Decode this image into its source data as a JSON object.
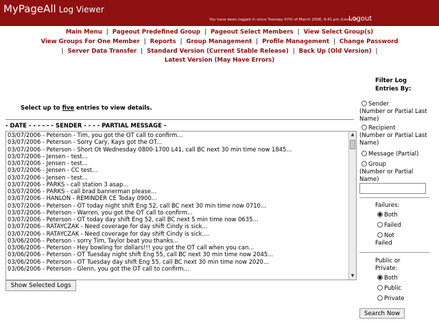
{
  "header": {
    "brand": "MyPageAll",
    "subtitle": "Log Viewer",
    "login_info": "You have been logged in since Tuesday 07th of March 2006, 9:41 pm (Level 2)",
    "logout": "Logout",
    "bg_color": "#8f1010"
  },
  "nav": {
    "link_color": "#8f1010",
    "lines": [
      [
        "Main Menu",
        "Pageout Predefined Group",
        "Pageout Select Members",
        "View Select Group(s)"
      ],
      [
        "View Groups For One Member",
        "Reports",
        "Group Management",
        "Profile Management",
        "Change Password"
      ],
      [
        "Server Data Transfer",
        "Standard Version (Current Stable Release)",
        "Back Up (Old Version)"
      ],
      [
        "Latest Version (May Have Errors)"
      ]
    ]
  },
  "main": {
    "instructions_prefix": "Select up to ",
    "instructions_emph": "five",
    "instructions_suffix": " entries to view details.",
    "column_header": "- DATE - - - - - - SENDER - - - - PARTIAL MESSAGE -",
    "show_button": "Show Selected Logs",
    "log_entries": [
      "03/07/2006 - Peterson - Tim, you got the OT call to confirm...",
      "03/07/2006 - Peterson - Sorry Cary, Kays got the OT...",
      "03/07/2006 - Peterson - Short Ot Wednesday 0800-1700 L41, call BC next 30 min time now 1845...",
      "03/07/2006 - Jensen - test...",
      "03/07/2006 - Jensen - test...",
      "03/07/2006 - Jensen - CC test...",
      "03/07/2006 - Jensen - test...",
      "03/07/2006 - PARKS - call station 3 asap...",
      "03/07/2006 - PARKS - call brad bannerman please...",
      "03/07/2006 - HANLON - REMINDER CE Today 0900...",
      "03/07/2006 - Peterson - OT today night shift Eng 52, call BC next 30 min time now 0710...",
      "03/07/2006 - Peterson - Warren, you got the OT call to confirm...",
      "03/07/2006 - Peterson - OT today day shift Eng 52, call BC next 5 min time now 0635...",
      "03/07/2006 - RATAYCZAK - Need coverage for day shift Cindy is sick...",
      "03/07/2006 - RATAYCZAK - Need coverage for day shift Cindy is sick....",
      "03/06/2006 - Peterson - sorry Tim, Taylor beat you thanks...",
      "03/06/2006 - Peterson - Hey bowling for dollars!!! you got the OT call when you can...",
      "03/06/2006 - Peterson - OT Tuesday night shift Eng 55, call BC next 30 min time now 2045...",
      "03/06/2006 - Peterson - OT Tuesday day shift Eng 55, call BC next 30 min time now 2020...",
      "03/06/2006 - Peterson - Glenn, you got the OT call to confirm..."
    ]
  },
  "filter": {
    "title_line1": "Filter Log",
    "title_line2": "Entries By:",
    "sender_label": "Sender",
    "sender_sub1": "(Number or Partial Last",
    "sender_sub2": "Name)",
    "recipient_label": "Recipient",
    "recipient_sub1": "(Number or Partial Last",
    "recipient_sub2": "Name)",
    "message_label": "Message (Partial)",
    "group_label": "Group",
    "group_sub1": "(Number or Partial",
    "group_sub2": "Name)",
    "search_value": "",
    "failures_title": "Failures:",
    "failures_both": "Both",
    "failures_failed": "Failed",
    "failures_not1": "Not",
    "failures_not2": "Failed",
    "public_title1": "Public or",
    "public_title2": "Private:",
    "public_both": "Both",
    "public_public": "Public",
    "public_private": "Private",
    "search_button": "Search Now"
  }
}
